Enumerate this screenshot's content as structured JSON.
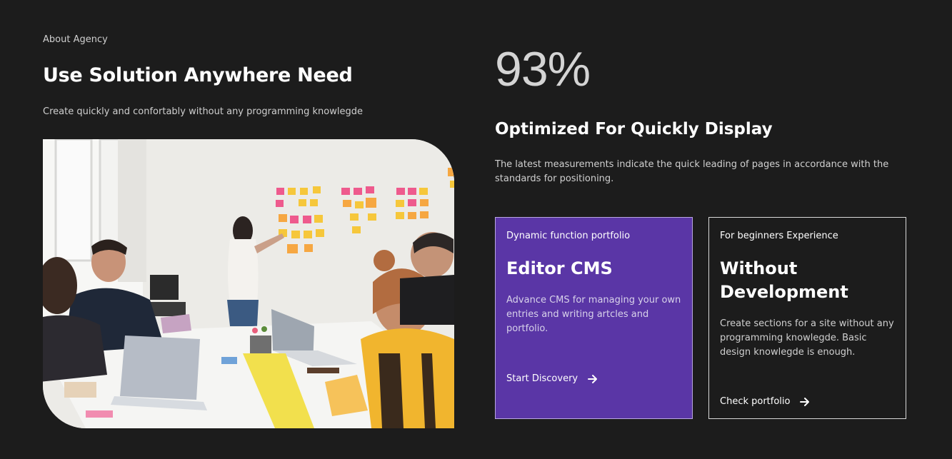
{
  "about": {
    "eyebrow": "About Agency",
    "heading": "Use Solution Anywhere Need",
    "subtext": "Create quickly and confortably without any programming knowlegde"
  },
  "stats": {
    "value": "93%",
    "title": "Optimized For Quickly Display",
    "text": "The latest measurements indicate the quick leading of pages in accordance with the standards for positioning."
  },
  "cards": [
    {
      "eyebrow": "Dynamic function portfolio",
      "title": "Editor CMS",
      "text": "Advance CMS for managing your own entries and writing artcles and portfolio.",
      "link": "Start Discovery"
    },
    {
      "eyebrow": "For beginners Experience",
      "title": "Without Development",
      "text": "Create sections for a site without any programming knowlegde. Basic design knowlegde is enough.",
      "link": "Check portfolio"
    }
  ],
  "colors": {
    "background": "#1c1c1c",
    "accent": "#5a36a6"
  },
  "icons": {
    "card_link": "arrow-right-icon",
    "photo": "team-meeting-photo"
  }
}
